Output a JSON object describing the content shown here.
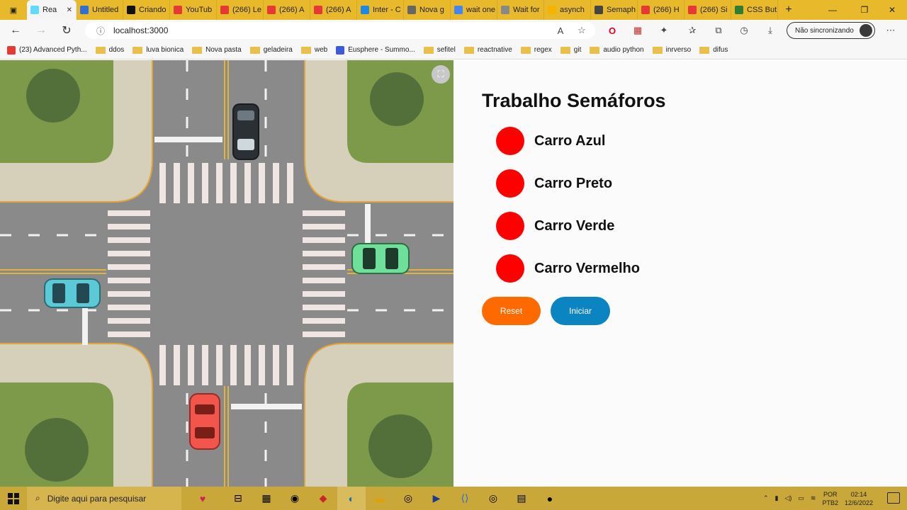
{
  "tabs": [
    {
      "label": "Rea",
      "color": "#61dafb",
      "active": true
    },
    {
      "label": "Untitled",
      "color": "#2f6fd6"
    },
    {
      "label": "Criando",
      "color": "#111111"
    },
    {
      "label": "YouTub",
      "color": "#e53935"
    },
    {
      "label": "(266) Le",
      "color": "#e53935"
    },
    {
      "label": "(266) A",
      "color": "#e53935"
    },
    {
      "label": "(266) A",
      "color": "#e53935"
    },
    {
      "label": "Inter - C",
      "color": "#1e88e5"
    },
    {
      "label": "Nova g",
      "color": "#666666"
    },
    {
      "label": "wait one",
      "color": "#4285f4"
    },
    {
      "label": "Wait for",
      "color": "#888888"
    },
    {
      "label": "asynch",
      "color": "#f4b400"
    },
    {
      "label": "Semaph",
      "color": "#444444"
    },
    {
      "label": "(266) H",
      "color": "#e53935"
    },
    {
      "label": "(266) Si",
      "color": "#e53935"
    },
    {
      "label": "CSS But",
      "color": "#2e7d32"
    }
  ],
  "address": {
    "url": "localhost:3000"
  },
  "profile": {
    "label": "Não sincronizando"
  },
  "bookmarks": [
    {
      "label": "(23) Advanced Pyth...",
      "kind": "youtube"
    },
    {
      "label": "ddos",
      "kind": "folder"
    },
    {
      "label": "luva bionica",
      "kind": "folder"
    },
    {
      "label": "Nova pasta",
      "kind": "folder"
    },
    {
      "label": "geladeira",
      "kind": "folder"
    },
    {
      "label": "web",
      "kind": "folder"
    },
    {
      "label": "Eusphere - Summo...",
      "kind": "site"
    },
    {
      "label": "sefitel",
      "kind": "folder"
    },
    {
      "label": "reactnative",
      "kind": "folder"
    },
    {
      "label": "regex",
      "kind": "folder"
    },
    {
      "label": "git",
      "kind": "folder"
    },
    {
      "label": "audio python",
      "kind": "folder"
    },
    {
      "label": "inrverso",
      "kind": "folder"
    },
    {
      "label": "difus",
      "kind": "folder"
    }
  ],
  "page": {
    "title": "Trabalho Semáforos",
    "lights": [
      {
        "label": "Carro Azul",
        "color": "#ff0000"
      },
      {
        "label": "Carro Preto",
        "color": "#ff0000"
      },
      {
        "label": "Carro Verde",
        "color": "#ff0000"
      },
      {
        "label": "Carro Vermelho",
        "color": "#ff0000"
      }
    ],
    "reset_label": "Reset",
    "reset_color": "#ff6a00",
    "start_label": "Iniciar",
    "start_color": "#0a85c2"
  },
  "taskbar": {
    "search_placeholder": "Digite aqui para pesquisar",
    "lang": "POR",
    "layout": "PTB2",
    "time": "02:14",
    "date": "12/6/2022"
  }
}
